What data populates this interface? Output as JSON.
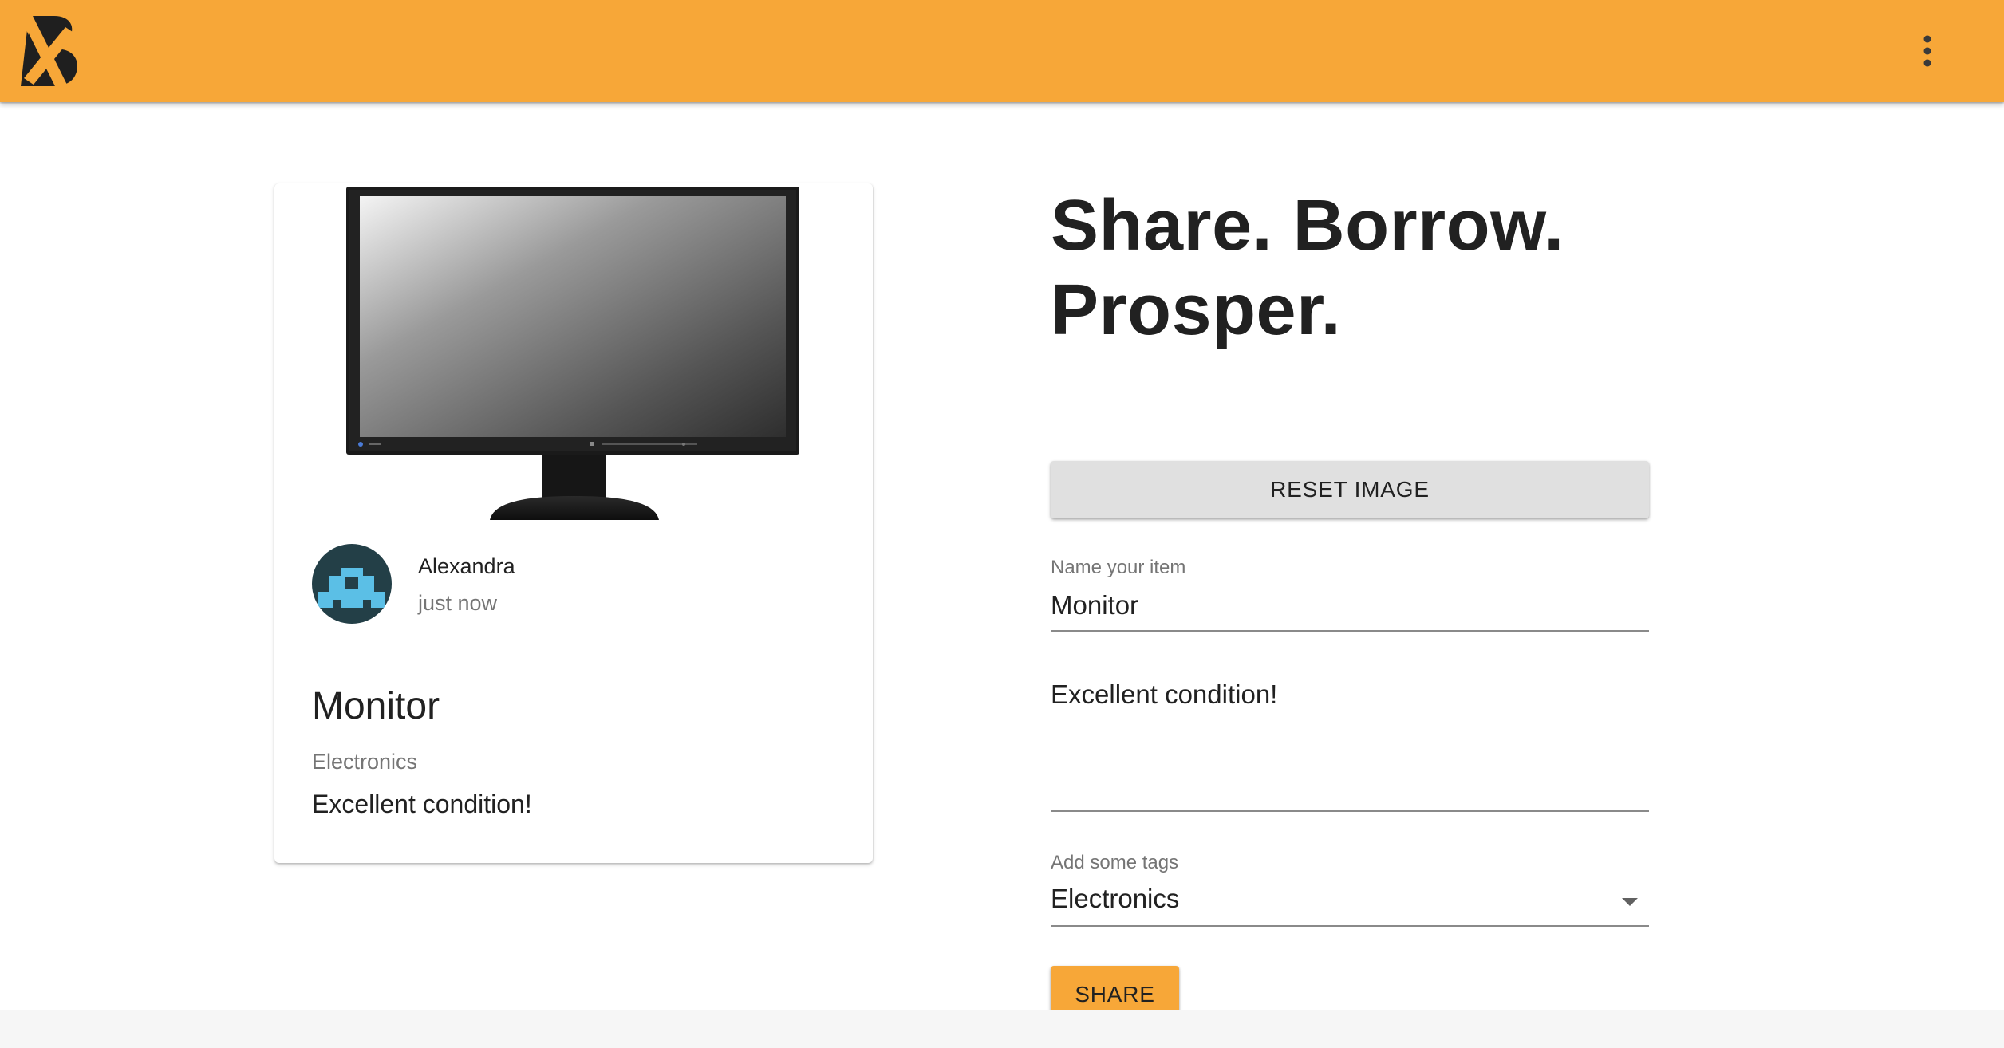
{
  "colors": {
    "appbar": "#f7a738",
    "primary_button": "#f7a738",
    "secondary_button": "#e0e0e0",
    "avatar_bg": "#233f47",
    "avatar_icon": "#5bbfe6"
  },
  "header": {
    "logo_icon": "boomtown-logo",
    "menu_icon": "more-vertical-icon"
  },
  "preview": {
    "image_icon": "monitor-image",
    "owner": {
      "name": "Alexandra",
      "time": "just now",
      "avatar_icon": "identicon-avatar"
    },
    "title": "Monitor",
    "tags": "Electronics",
    "description": "Excellent condition!"
  },
  "form": {
    "headline": "Share. Borrow. Prosper.",
    "reset_label": "RESET IMAGE",
    "name_label": "Name your item",
    "name_value": "Monitor",
    "description_value": "Excellent condition!",
    "tags_label": "Add some tags",
    "tags_value": "Electronics",
    "share_label": "SHARE"
  }
}
